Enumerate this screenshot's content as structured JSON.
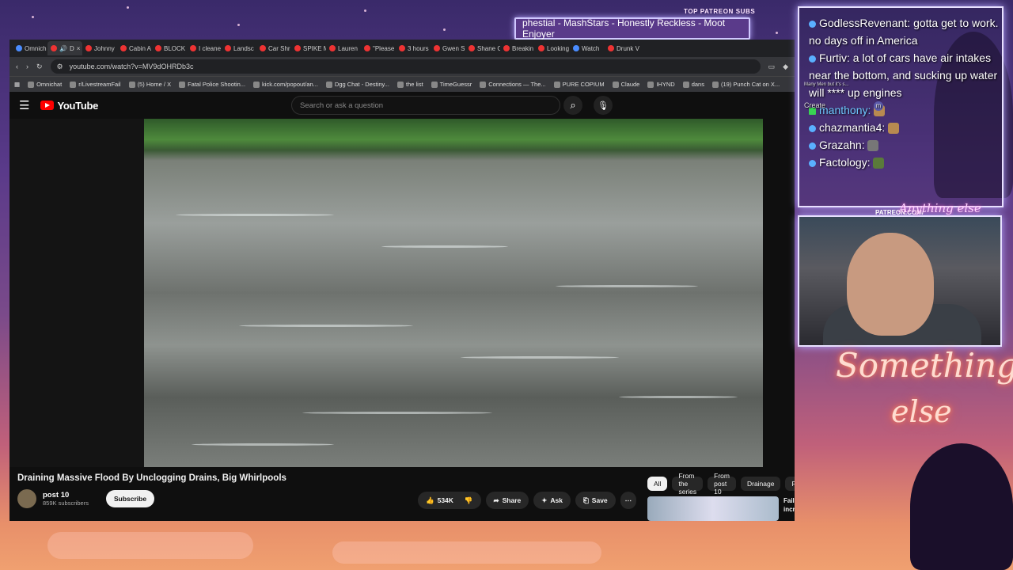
{
  "overlay": {
    "top_patreon_label": "TOP PATREON SUBS",
    "ticker_text": "phestial - MashStars - Honestly Reckless - Moot Enjoyer",
    "patreon_cam_label": "PATREON.COM/",
    "patreon_signature": "Anything else",
    "logo_line1": "Something",
    "logo_line2": "else",
    "ghost_create": "Create",
    "ghost_mini": "Many Men but it's s...",
    "ghost_avatar": "m"
  },
  "chat": [
    {
      "user": "GodlessRevenant:",
      "text": " gotta get to work. no days off in America",
      "badge": "blue"
    },
    {
      "user": "Furtiv:",
      "text": " a lot of cars have air intakes near the bottom, and sucking up water will **** up engines",
      "badge": "blue"
    },
    {
      "user": "manthony:",
      "text": "",
      "badge": "green"
    },
    {
      "user": "chazmantia4:",
      "text": "",
      "badge": "blue"
    },
    {
      "user": "Grazahn:",
      "text": "",
      "badge": "blue"
    },
    {
      "user": "Factology:",
      "text": "",
      "badge": "blue"
    }
  ],
  "browser": {
    "tabs": [
      "Omnich",
      "D",
      "Johnny",
      "Cabin A",
      "BLOCK",
      "I cleane",
      "Landsc",
      "Car Shr",
      "SPIKE M",
      "Lauren",
      "\"Please",
      "3 hours",
      "Gwen S",
      "Shane C",
      "Breakin",
      "Looking",
      "Watch",
      "Drunk V"
    ],
    "url": "youtube.com/watch?v=MV9dOHRDb3c",
    "bookmarks": [
      "Omnichat",
      "r/LivestreamFail",
      "(5) Home / X",
      "Fatal Police Shootin...",
      "kick.com/popout/an...",
      "Dgg Chat - Destiny...",
      "the list",
      "TimeGuessr",
      "Connections — The...",
      "PURE COPIUM",
      "Claude",
      "IHYND",
      "dans",
      "(19) Punch Cat on X..."
    ]
  },
  "youtube": {
    "logo_text": "YouTube",
    "search_placeholder": "Search or ask a question",
    "video_title": "Draining Massive Flood By Unclogging Drains, Big Whirlpools",
    "channel_name": "post 10",
    "subscribers": "859K subscribers",
    "subscribe_label": "Subscribe",
    "like_count": "534K",
    "share_label": "Share",
    "ask_label": "Ask",
    "save_label": "Save",
    "chips": [
      "All",
      "From the series",
      "From post 10",
      "Drainage",
      "Related"
    ],
    "rec_title": "Fail videos but they get increasingly more expensive"
  },
  "icons": {
    "menu": "hamburger-icon",
    "search": "search-icon",
    "mic": "mic-icon",
    "like": "thumbs-up-icon",
    "dislike": "thumbs-down-icon",
    "share": "share-icon",
    "ask": "sparkle-icon",
    "save": "bookmark-icon",
    "more": "more-icon"
  },
  "colors": {
    "yt_red": "#ff0000",
    "overlay_border": "#e8e0ff",
    "chat_blue_badge": "#5ab0ff",
    "chat_green_badge": "#39d353"
  }
}
